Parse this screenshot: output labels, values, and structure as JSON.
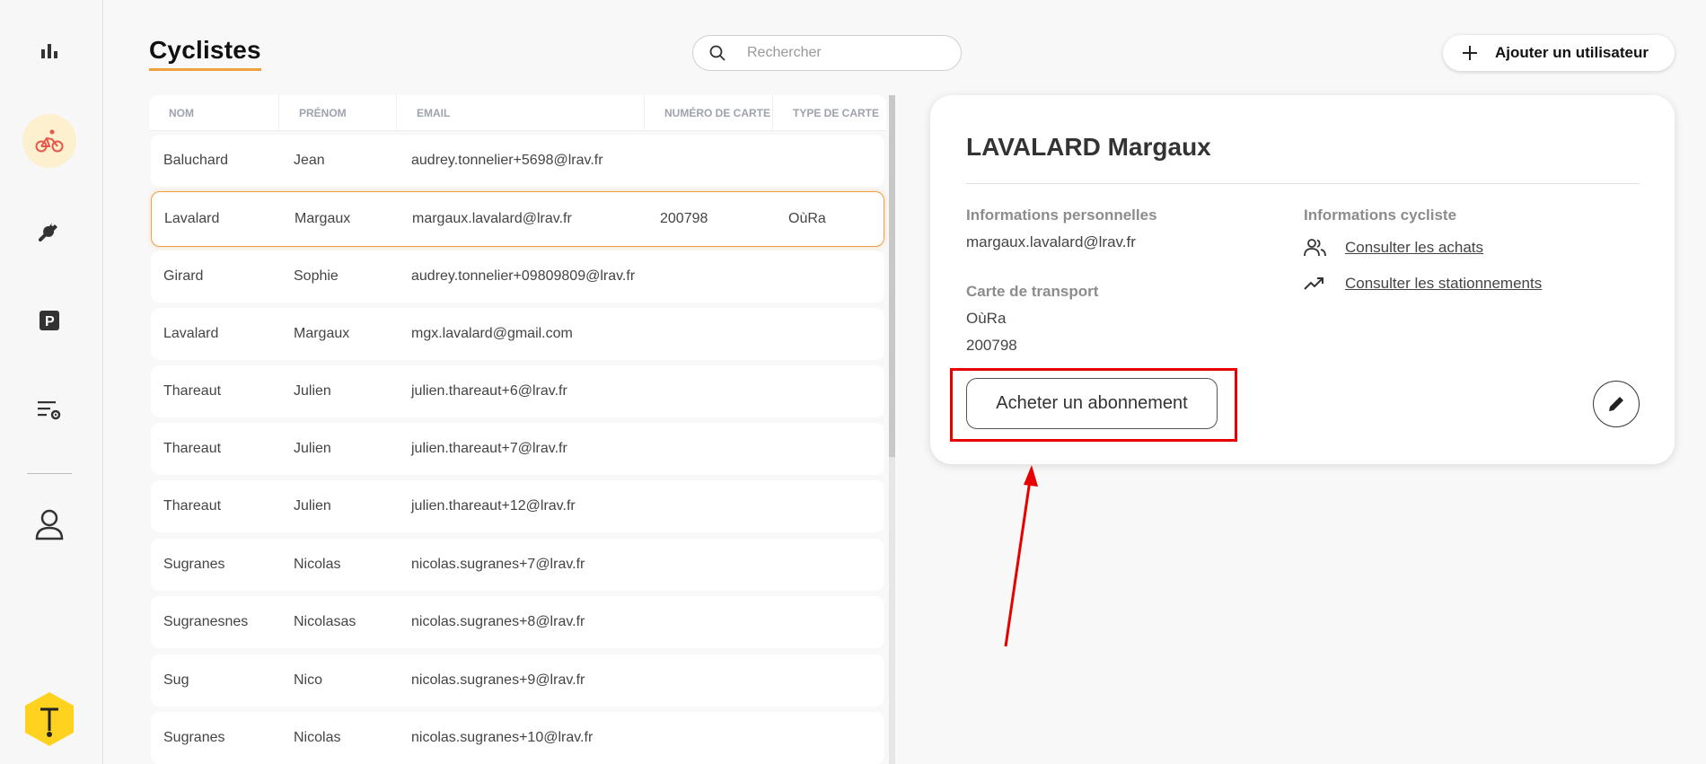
{
  "header": {
    "title": "Cyclistes",
    "search_placeholder": "Rechercher",
    "add_user_label": "Ajouter un utilisateur"
  },
  "sidebar": {
    "items": [
      {
        "name": "stats",
        "icon": "bar-chart-icon"
      },
      {
        "name": "cyclists",
        "icon": "cyclist-icon",
        "active": true
      },
      {
        "name": "maintenance",
        "icon": "wrench-icon"
      },
      {
        "name": "parking",
        "icon": "parking-icon"
      },
      {
        "name": "settings-list",
        "icon": "list-settings-icon"
      },
      {
        "name": "profile",
        "icon": "user-icon"
      }
    ],
    "logo": "brand-logo"
  },
  "table": {
    "columns": [
      "NOM",
      "PRÉNOM",
      "EMAIL",
      "NUMÉRO DE CARTE",
      "TYPE DE CARTE"
    ],
    "rows": [
      {
        "nom": "Baluchard",
        "prenom": "Jean",
        "email": "audrey.tonnelier+5698@lrav.fr",
        "carte": "",
        "type": ""
      },
      {
        "nom": "Lavalard",
        "prenom": "Margaux",
        "email": "margaux.lavalard@lrav.fr",
        "carte": "200798",
        "type": "OùRa"
      },
      {
        "nom": "Girard",
        "prenom": "Sophie",
        "email": "audrey.tonnelier+09809809@lrav.fr",
        "carte": "",
        "type": ""
      },
      {
        "nom": "Lavalard",
        "prenom": "Margaux",
        "email": "mgx.lavalard@gmail.com",
        "carte": "",
        "type": ""
      },
      {
        "nom": "Thareaut",
        "prenom": "Julien",
        "email": "julien.thareaut+6@lrav.fr",
        "carte": "",
        "type": ""
      },
      {
        "nom": "Thareaut",
        "prenom": "Julien",
        "email": "julien.thareaut+7@lrav.fr",
        "carte": "",
        "type": ""
      },
      {
        "nom": "Thareaut",
        "prenom": "Julien",
        "email": "julien.thareaut+12@lrav.fr",
        "carte": "",
        "type": ""
      },
      {
        "nom": "Sugranes",
        "prenom": "Nicolas",
        "email": "nicolas.sugranes+7@lrav.fr",
        "carte": "",
        "type": ""
      },
      {
        "nom": "Sugranesnes",
        "prenom": "Nicolasas",
        "email": "nicolas.sugranes+8@lrav.fr",
        "carte": "",
        "type": ""
      },
      {
        "nom": "Sug",
        "prenom": "Nico",
        "email": "nicolas.sugranes+9@lrav.fr",
        "carte": "",
        "type": ""
      },
      {
        "nom": "Sugranes",
        "prenom": "Nicolas",
        "email": "nicolas.sugranes+10@lrav.fr",
        "carte": "",
        "type": ""
      }
    ],
    "selected_index": 1
  },
  "detail": {
    "name": "LAVALARD Margaux",
    "personal_title": "Informations personnelles",
    "email": "margaux.lavalard@lrav.fr",
    "transport_title": "Carte de transport",
    "card_type": "OùRa",
    "card_number": "200798",
    "cyclist_title": "Informations cycliste",
    "link_purchases": "Consulter les achats",
    "link_parkings": "Consulter les stationnements",
    "buy_button": "Acheter un abonnement"
  },
  "annotation": {
    "highlight_color": "#e60000"
  },
  "colors": {
    "accent": "#f2a03d",
    "active_nav_bg": "#fdf0cf",
    "cyclist_icon": "#e8574a",
    "logo_yellow": "#ffd21f"
  }
}
